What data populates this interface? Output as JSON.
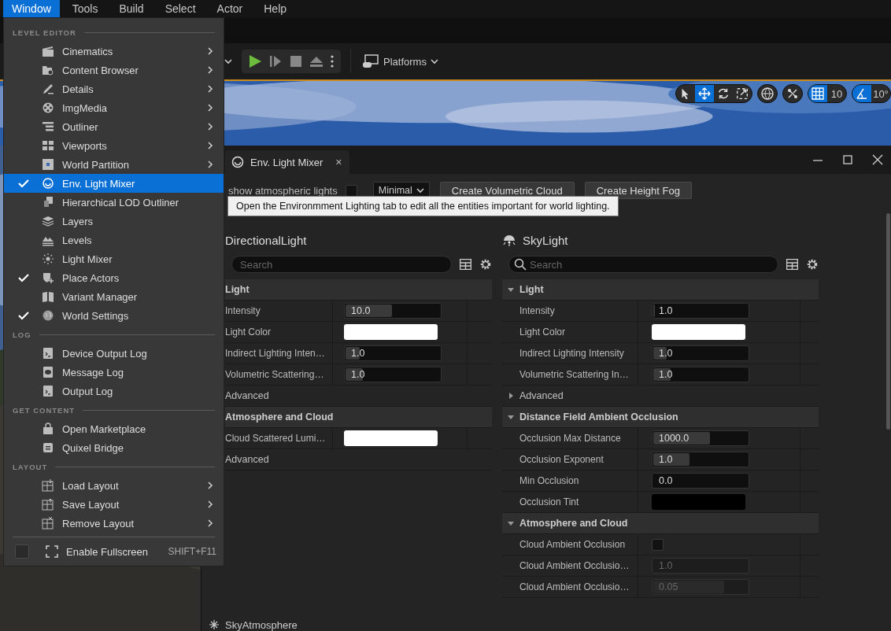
{
  "menubar": [
    {
      "label": "Window",
      "selected": true
    },
    {
      "label": "Tools",
      "selected": false
    },
    {
      "label": "Build",
      "selected": false
    },
    {
      "label": "Select",
      "selected": false
    },
    {
      "label": "Actor",
      "selected": false
    },
    {
      "label": "Help",
      "selected": false
    }
  ],
  "window_menu": {
    "sections": [
      {
        "title": "LEVEL EDITOR",
        "items": [
          {
            "label": "Cinematics",
            "checked": false,
            "submenu": true,
            "selected": false
          },
          {
            "label": "Content Browser",
            "checked": false,
            "submenu": true,
            "selected": false
          },
          {
            "label": "Details",
            "checked": false,
            "submenu": true,
            "selected": false
          },
          {
            "label": "ImgMedia",
            "checked": false,
            "submenu": true,
            "selected": false
          },
          {
            "label": "Outliner",
            "checked": false,
            "submenu": true,
            "selected": false
          },
          {
            "label": "Viewports",
            "checked": false,
            "submenu": true,
            "selected": false
          },
          {
            "label": "World Partition",
            "checked": false,
            "submenu": true,
            "selected": false
          },
          {
            "label": "Env. Light Mixer",
            "checked": true,
            "submenu": false,
            "selected": true
          },
          {
            "label": "Hierarchical LOD Outliner",
            "checked": false,
            "submenu": false,
            "selected": false
          },
          {
            "label": "Layers",
            "checked": false,
            "submenu": false,
            "selected": false
          },
          {
            "label": "Levels",
            "checked": false,
            "submenu": false,
            "selected": false
          },
          {
            "label": "Light Mixer",
            "checked": false,
            "submenu": false,
            "selected": false
          },
          {
            "label": "Place Actors",
            "checked": true,
            "submenu": false,
            "selected": false
          },
          {
            "label": "Variant Manager",
            "checked": false,
            "submenu": false,
            "selected": false
          },
          {
            "label": "World Settings",
            "checked": true,
            "submenu": false,
            "selected": false
          }
        ]
      },
      {
        "title": "LOG",
        "items": [
          {
            "label": "Device Output Log",
            "checked": false,
            "submenu": false,
            "selected": false
          },
          {
            "label": "Message Log",
            "checked": false,
            "submenu": false,
            "selected": false
          },
          {
            "label": "Output Log",
            "checked": false,
            "submenu": false,
            "selected": false
          }
        ]
      },
      {
        "title": "GET CONTENT",
        "items": [
          {
            "label": "Open Marketplace",
            "checked": false,
            "submenu": false,
            "selected": false
          },
          {
            "label": "Quixel Bridge",
            "checked": false,
            "submenu": false,
            "selected": false
          }
        ]
      },
      {
        "title": "LAYOUT",
        "items": [
          {
            "label": "Load Layout",
            "checked": false,
            "submenu": true,
            "selected": false
          },
          {
            "label": "Save Layout",
            "checked": false,
            "submenu": true,
            "selected": false
          },
          {
            "label": "Remove Layout",
            "checked": false,
            "submenu": true,
            "selected": false
          }
        ]
      }
    ],
    "fullscreen": {
      "label": "Enable Fullscreen",
      "checked": false,
      "shortcut": "SHIFT+F11"
    }
  },
  "toolbar": {
    "platforms": "Platforms"
  },
  "viewport_toolbar": {
    "tools": [
      {
        "selected": false
      },
      {
        "selected": true
      },
      {
        "selected": false
      },
      {
        "selected": false
      }
    ],
    "grid_snap": "10",
    "rotation_snap": "10°"
  },
  "panel": {
    "tab": "Env. Light Mixer",
    "tab_close": "×",
    "show_atmospheric_lights": {
      "label": "show atmospheric lights",
      "checked": false
    },
    "mode": "Minimal",
    "buttons": [
      "Create Volumetric Cloud",
      "Create Height Fog"
    ],
    "tooltip": "Open the Environmment Lighting tab to edit all the entities important for world lighting.",
    "columns": [
      {
        "title": "DirectionalLight",
        "search_placeholder": "Search",
        "sections": [
          {
            "kind": "category",
            "name": "Light",
            "rows": [
              {
                "kind": "number",
                "name": "Intensity",
                "value": "10.0",
                "level": 0.48,
                "disabled": false
              },
              {
                "kind": "color",
                "name": "Light Color",
                "color": "#ffffff"
              },
              {
                "kind": "number",
                "name": "Indirect Lighting Inten…",
                "value": "1.0",
                "level": 0.15,
                "disabled": false
              },
              {
                "kind": "number",
                "name": "Volumetric Scattering…",
                "value": "1.0",
                "level": 0.18,
                "disabled": false
              }
            ]
          },
          {
            "kind": "group",
            "name": "Advanced"
          },
          {
            "kind": "category",
            "name": "Atmosphere and Cloud",
            "rows": [
              {
                "kind": "color",
                "name": "Cloud Scattered Lumi…",
                "color": "#ffffff"
              }
            ]
          },
          {
            "kind": "group",
            "name": "Advanced"
          }
        ]
      },
      {
        "title": "SkyLight",
        "search_placeholder": "Search",
        "sections": [
          {
            "kind": "category",
            "name": "Light",
            "expanded": true,
            "rows": [
              {
                "kind": "number",
                "name": "Intensity",
                "value": "1.0",
                "level": 0.02,
                "disabled": false
              },
              {
                "kind": "color",
                "name": "Light Color",
                "color": "#ffffff"
              },
              {
                "kind": "number",
                "name": "Indirect Lighting Intensity",
                "value": "1.0",
                "level": 0.14,
                "disabled": false
              },
              {
                "kind": "number",
                "name": "Volumetric Scattering In…",
                "value": "1.0",
                "level": 0.18,
                "disabled": false
              }
            ]
          },
          {
            "kind": "group",
            "name": "Advanced",
            "expanded": false
          },
          {
            "kind": "category",
            "name": "Distance Field Ambient Occlusion",
            "expanded": true,
            "rows": [
              {
                "kind": "number",
                "name": "Occlusion Max Distance",
                "value": "1000.0",
                "level": 0.59,
                "disabled": false
              },
              {
                "kind": "number",
                "name": "Occlusion Exponent",
                "value": "1.0",
                "level": 0.38,
                "disabled": false
              },
              {
                "kind": "number",
                "name": "Min Occlusion",
                "value": "0.0",
                "level": 0,
                "disabled": false
              },
              {
                "kind": "color",
                "name": "Occlusion Tint",
                "color": "#000000"
              }
            ]
          },
          {
            "kind": "category",
            "name": "Atmosphere and Cloud",
            "expanded": true,
            "rows": [
              {
                "kind": "checkbox",
                "name": "Cloud Ambient Occlusion",
                "checked": false
              },
              {
                "kind": "number",
                "name": "Cloud Ambient Occlusio…",
                "value": "1.0",
                "level": 0,
                "disabled": true
              },
              {
                "kind": "number",
                "name": "Cloud Ambient Occlusio…",
                "value": "0.05",
                "level": 0.74,
                "disabled": true
              }
            ]
          }
        ]
      }
    ],
    "footer_item": "SkyAtmosphere"
  }
}
